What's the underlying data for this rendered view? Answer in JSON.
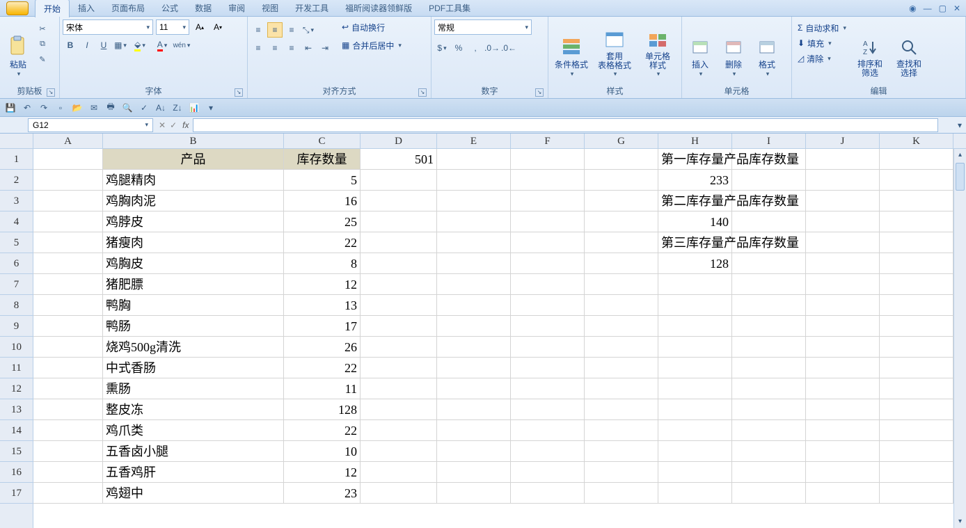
{
  "tabs": [
    "开始",
    "插入",
    "页面布局",
    "公式",
    "数据",
    "审阅",
    "视图",
    "开发工具",
    "福昕阅读器领鲜版",
    "PDF工具集"
  ],
  "activeTab": 0,
  "ribbon": {
    "clipboard": {
      "paste": "粘贴",
      "label": "剪贴板"
    },
    "font": {
      "name": "宋体",
      "size": "11",
      "label": "字体",
      "buttons": {
        "bold": "B",
        "italic": "I",
        "underline": "U"
      }
    },
    "align": {
      "wrap": "自动换行",
      "merge": "合并后居中",
      "label": "对齐方式"
    },
    "number": {
      "format": "常规",
      "label": "数字",
      "percent": "%",
      "comma": ","
    },
    "styles": {
      "cond": "条件格式",
      "table": "套用\n表格格式",
      "cell": "单元格\n样式",
      "label": "样式"
    },
    "cells": {
      "insert": "插入",
      "delete": "删除",
      "format": "格式",
      "label": "单元格"
    },
    "editing": {
      "sum": "自动求和",
      "fill": "填充",
      "clear": "清除",
      "sort": "排序和\n筛选",
      "find": "查找和\n选择",
      "label": "编辑"
    }
  },
  "namebox": "G12",
  "columns": [
    "A",
    "B",
    "C",
    "D",
    "E",
    "F",
    "G",
    "H",
    "I",
    "J",
    "K"
  ],
  "rows": [
    "1",
    "2",
    "3",
    "4",
    "5",
    "6",
    "7",
    "8",
    "9",
    "10",
    "11",
    "12",
    "13",
    "14",
    "15",
    "16",
    "17"
  ],
  "sheet": {
    "B1": "产品",
    "C1": "库存数量",
    "D1": "501",
    "H1": "第一库存量产品库存数量",
    "H2": "233",
    "H3": "第二库存量产品库存数量",
    "H4": "140",
    "H5": "第三库存量产品库存数量",
    "H6": "128",
    "B2": "鸡腿精肉",
    "C2": "5",
    "B3": "鸡胸肉泥",
    "C3": "16",
    "B4": "鸡脖皮",
    "C4": "25",
    "B5": "猪瘦肉",
    "C5": "22",
    "B6": "鸡胸皮",
    "C6": "8",
    "B7": "猪肥膘",
    "C7": "12",
    "B8": "鸭胸",
    "C8": "13",
    "B9": "鸭肠",
    "C9": "17",
    "B10": "烧鸡500g清洗",
    "C10": "26",
    "B11": "中式香肠",
    "C11": "22",
    "B12": "熏肠",
    "C12": "11",
    "B13": "整皮冻",
    "C13": "128",
    "B14": "鸡爪类",
    "C14": "22",
    "B15": "五香卤小腿",
    "C15": "10",
    "B16": "五香鸡肝",
    "C16": "12",
    "B17": "鸡翅中",
    "C17": "23"
  }
}
